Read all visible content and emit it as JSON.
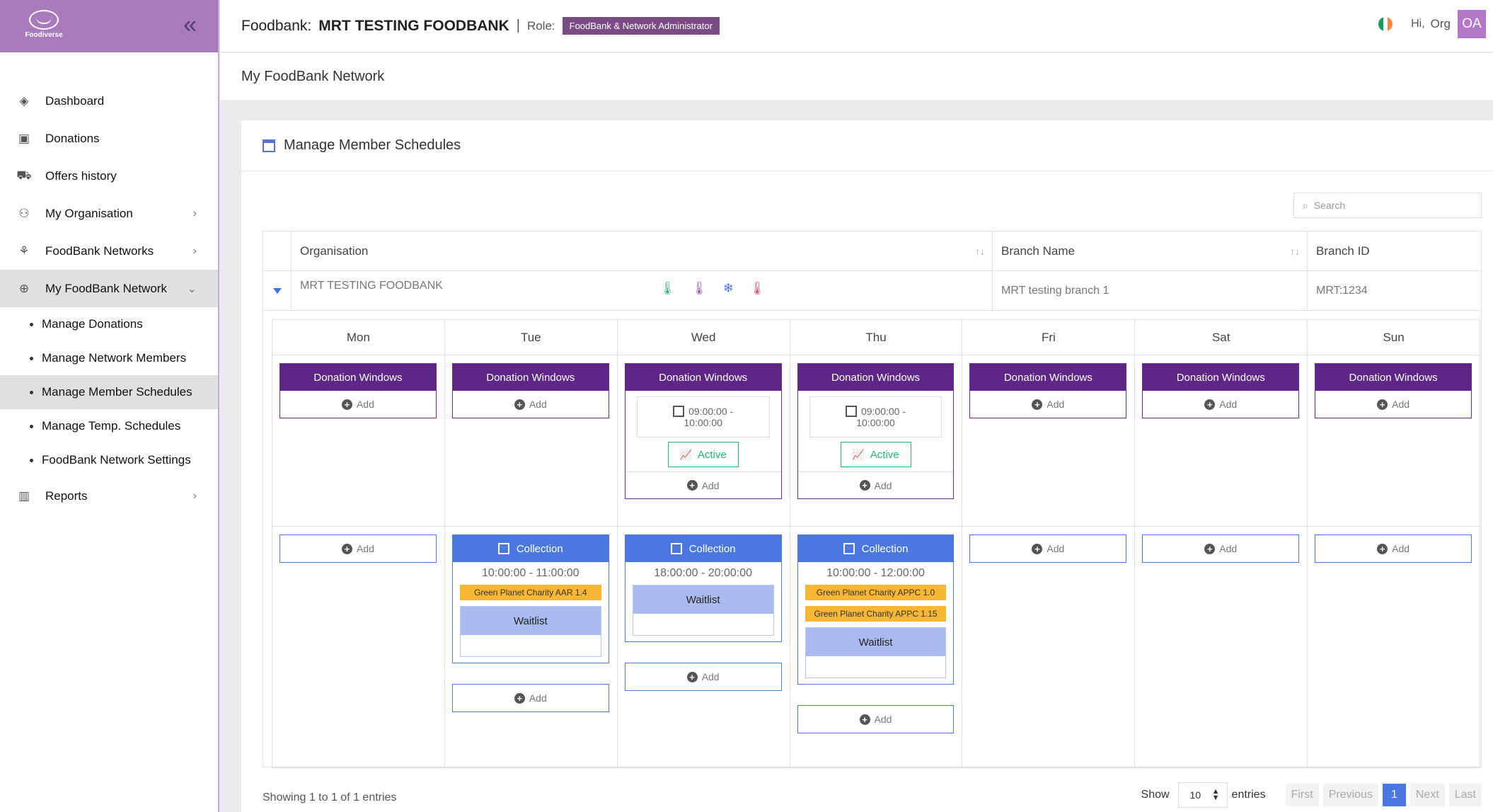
{
  "app": {
    "logo_text": "Foodiverse"
  },
  "sidebar": {
    "items": [
      {
        "label": "Dashboard",
        "icon": "layers-icon"
      },
      {
        "label": "Donations",
        "icon": "box-icon"
      },
      {
        "label": "Offers history",
        "icon": "cart-icon"
      },
      {
        "label": "My Organisation",
        "icon": "org-icon",
        "chevron": ">"
      },
      {
        "label": "FoodBank Networks",
        "icon": "network-icon",
        "chevron": ">"
      },
      {
        "label": "My FoodBank Network",
        "icon": "globe-icon",
        "chevron": "v"
      }
    ],
    "sub_items": [
      {
        "label": "Manage Donations"
      },
      {
        "label": "Manage Network Members"
      },
      {
        "label": "Manage Member Schedules"
      },
      {
        "label": "Manage Temp. Schedules"
      },
      {
        "label": "FoodBank Network Settings"
      }
    ],
    "reports": {
      "label": "Reports",
      "icon": "bar-chart-icon"
    }
  },
  "header": {
    "foodbank_label": "Foodbank:",
    "foodbank_name": "MRT TESTING FOODBANK",
    "separator": "|",
    "role_label": "Role:",
    "role_badge": "FoodBank & Network Administrator",
    "greeting": "Hi,",
    "user_name": "Org",
    "avatar_initials": "OA",
    "flag_colors": [
      "#169b62",
      "#ffffff",
      "#ff883e"
    ]
  },
  "page_title": "My FoodBank Network",
  "card": {
    "title": "Manage Member Schedules",
    "search_placeholder": "Search"
  },
  "table": {
    "columns": [
      "Organisation",
      "Branch Name",
      "Branch ID"
    ],
    "row": {
      "organisation": "MRT TESTING FOODBANK",
      "branch_name": "MRT testing branch 1",
      "branch_id": "MRT:1234"
    }
  },
  "schedule": {
    "donation_windows_label": "Donation Windows",
    "add_label": "Add",
    "collection_label": "Collection",
    "waitlist_label": "Waitlist",
    "active_label": "Active",
    "days": [
      {
        "name": "Mon"
      },
      {
        "name": "Tue",
        "collection_time": "10:00:00 - 11:00:00",
        "tags": [
          "Green Planet Charity AAR 1.4"
        ]
      },
      {
        "name": "Wed",
        "window_time": "09:00:00 -",
        "window_time2": "10:00:00",
        "collection_time": "18:00:00 - 20:00:00",
        "tags": []
      },
      {
        "name": "Thu",
        "window_time": "09:00:00 -",
        "window_time2": "10:00:00",
        "collection_time": "10:00:00 - 12:00:00",
        "tags": [
          "Green Planet Charity APPC 1.0",
          "Green Planet Charity APPC 1.15"
        ]
      },
      {
        "name": "Fri"
      },
      {
        "name": "Sat"
      },
      {
        "name": "Sun"
      }
    ]
  },
  "footer": {
    "info": "Showing 1 to 1 of 1 entries",
    "show_label": "Show",
    "page_length": "10",
    "entries_label": "entries",
    "pager": [
      "First",
      "Previous",
      "1",
      "Next",
      "Last"
    ]
  }
}
